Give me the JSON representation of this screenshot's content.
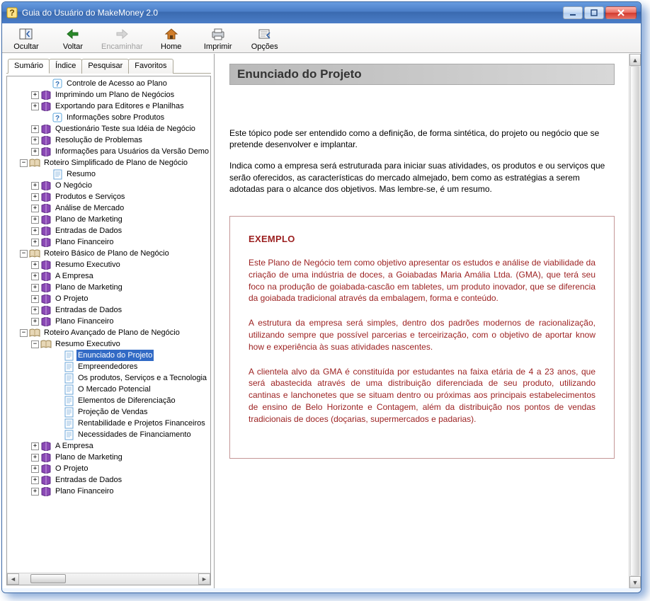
{
  "window": {
    "title": "Guia do Usuário do MakeMoney 2.0"
  },
  "toolbar": {
    "btn_ocultar": "Ocultar",
    "btn_voltar": "Voltar",
    "btn_encaminhar": "Encaminhar",
    "btn_home": "Home",
    "btn_imprimir": "Imprimir",
    "btn_opcoes": "Opções"
  },
  "tabs": {
    "sumario": "Sumário",
    "indice": "Índice",
    "pesquisar": "Pesquisar",
    "favoritos": "Favoritos"
  },
  "tree": [
    {
      "d": 3,
      "exp": "none",
      "icon": "help",
      "label": "Controle de Acesso ao Plano"
    },
    {
      "d": 2,
      "exp": "plus",
      "icon": "book",
      "label": "Imprimindo um Plano de Negócios"
    },
    {
      "d": 2,
      "exp": "plus",
      "icon": "book",
      "label": "Exportando para Editores e Planilhas"
    },
    {
      "d": 3,
      "exp": "none",
      "icon": "help",
      "label": "Informações sobre Produtos"
    },
    {
      "d": 2,
      "exp": "plus",
      "icon": "book",
      "label": "Questionário Teste sua Idéia de Negócio"
    },
    {
      "d": 2,
      "exp": "plus",
      "icon": "book",
      "label": "Resolução de Problemas"
    },
    {
      "d": 2,
      "exp": "plus",
      "icon": "book",
      "label": "Informações para Usuários da Versão Demo"
    },
    {
      "d": 1,
      "exp": "minus",
      "icon": "obook",
      "label": "Roteiro Simplificado de Plano de Negócio"
    },
    {
      "d": 3,
      "exp": "none",
      "icon": "page",
      "label": "Resumo"
    },
    {
      "d": 2,
      "exp": "plus",
      "icon": "book",
      "label": "O Negócio"
    },
    {
      "d": 2,
      "exp": "plus",
      "icon": "book",
      "label": "Produtos e Serviços"
    },
    {
      "d": 2,
      "exp": "plus",
      "icon": "book",
      "label": "Análise de Mercado"
    },
    {
      "d": 2,
      "exp": "plus",
      "icon": "book",
      "label": "Plano de Marketing"
    },
    {
      "d": 2,
      "exp": "plus",
      "icon": "book",
      "label": "Entradas de Dados"
    },
    {
      "d": 2,
      "exp": "plus",
      "icon": "book",
      "label": "Plano Financeiro"
    },
    {
      "d": 1,
      "exp": "minus",
      "icon": "obook",
      "label": "Roteiro Básico de Plano de Negócio"
    },
    {
      "d": 2,
      "exp": "plus",
      "icon": "book",
      "label": "Resumo Executivo"
    },
    {
      "d": 2,
      "exp": "plus",
      "icon": "book",
      "label": "A Empresa"
    },
    {
      "d": 2,
      "exp": "plus",
      "icon": "book",
      "label": "Plano de Marketing"
    },
    {
      "d": 2,
      "exp": "plus",
      "icon": "book",
      "label": "O Projeto"
    },
    {
      "d": 2,
      "exp": "plus",
      "icon": "book",
      "label": "Entradas de Dados"
    },
    {
      "d": 2,
      "exp": "plus",
      "icon": "book",
      "label": "Plano Financeiro"
    },
    {
      "d": 1,
      "exp": "minus",
      "icon": "obook",
      "label": "Roteiro Avançado de Plano de Negócio"
    },
    {
      "d": 2,
      "exp": "minus",
      "icon": "obook",
      "label": "Resumo Executivo"
    },
    {
      "d": 4,
      "exp": "none",
      "icon": "page",
      "label": "Enunciado do Projeto",
      "selected": true
    },
    {
      "d": 4,
      "exp": "none",
      "icon": "page",
      "label": "Empreendedores"
    },
    {
      "d": 4,
      "exp": "none",
      "icon": "page",
      "label": "Os produtos, Serviços e a Tecnologia"
    },
    {
      "d": 4,
      "exp": "none",
      "icon": "page",
      "label": "O Mercado Potencial"
    },
    {
      "d": 4,
      "exp": "none",
      "icon": "page",
      "label": "Elementos de Diferenciação"
    },
    {
      "d": 4,
      "exp": "none",
      "icon": "page",
      "label": "Projeção de Vendas"
    },
    {
      "d": 4,
      "exp": "none",
      "icon": "page",
      "label": "Rentabilidade e Projetos Financeiros"
    },
    {
      "d": 4,
      "exp": "none",
      "icon": "page",
      "label": "Necessidades de Financiamento"
    },
    {
      "d": 2,
      "exp": "plus",
      "icon": "book",
      "label": "A Empresa"
    },
    {
      "d": 2,
      "exp": "plus",
      "icon": "book",
      "label": "Plano de Marketing"
    },
    {
      "d": 2,
      "exp": "plus",
      "icon": "book",
      "label": "O Projeto"
    },
    {
      "d": 2,
      "exp": "plus",
      "icon": "book",
      "label": "Entradas de Dados"
    },
    {
      "d": 2,
      "exp": "plus",
      "icon": "book",
      "label": "Plano Financeiro"
    }
  ],
  "content": {
    "title": "Enunciado do Projeto",
    "p1": "Este tópico pode ser entendido como a definição, de forma sintética, do projeto ou negócio que se pretende desenvolver e implantar.",
    "p2": "Indica como a empresa será estruturada para iniciar suas atividades, os produtos e ou serviços que serão oferecidos, as características do mercado almejado, bem como as estratégias a serem adotadas para o alcance dos objetivos. Mas lembre-se, é um resumo.",
    "example_title": "EXEMPLO",
    "ex_p1": "Este Plano de Negócio tem como objetivo apresentar os estudos e análise de viabilidade da criação de uma indústria de doces, a Goiabadas Maria Amália Ltda. (GMA), que terá seu foco na produção de goiabada-cascão em tabletes, um produto inovador, que se diferencia da goiabada tradicional através da embalagem, forma e conteúdo.",
    "ex_p2": "A estrutura da empresa será simples, dentro dos padrões modernos de racionalização, utilizando sempre que possível parcerias e terceirização, com o objetivo de aportar know how e experiência às suas atividades nascentes.",
    "ex_p3": "A clientela alvo da GMA é constituída por estudantes na faixa etária de 4 a 23 anos, que será abastecida através de uma distribuição diferenciada de seu produto, utilizando cantinas e lanchonetes que se situam dentro ou próximas aos principais estabelecimentos de ensino de Belo Horizonte e Contagem, além da distribuição nos pontos de vendas tradicionais de doces (doçarias, supermercados e padarias)."
  }
}
